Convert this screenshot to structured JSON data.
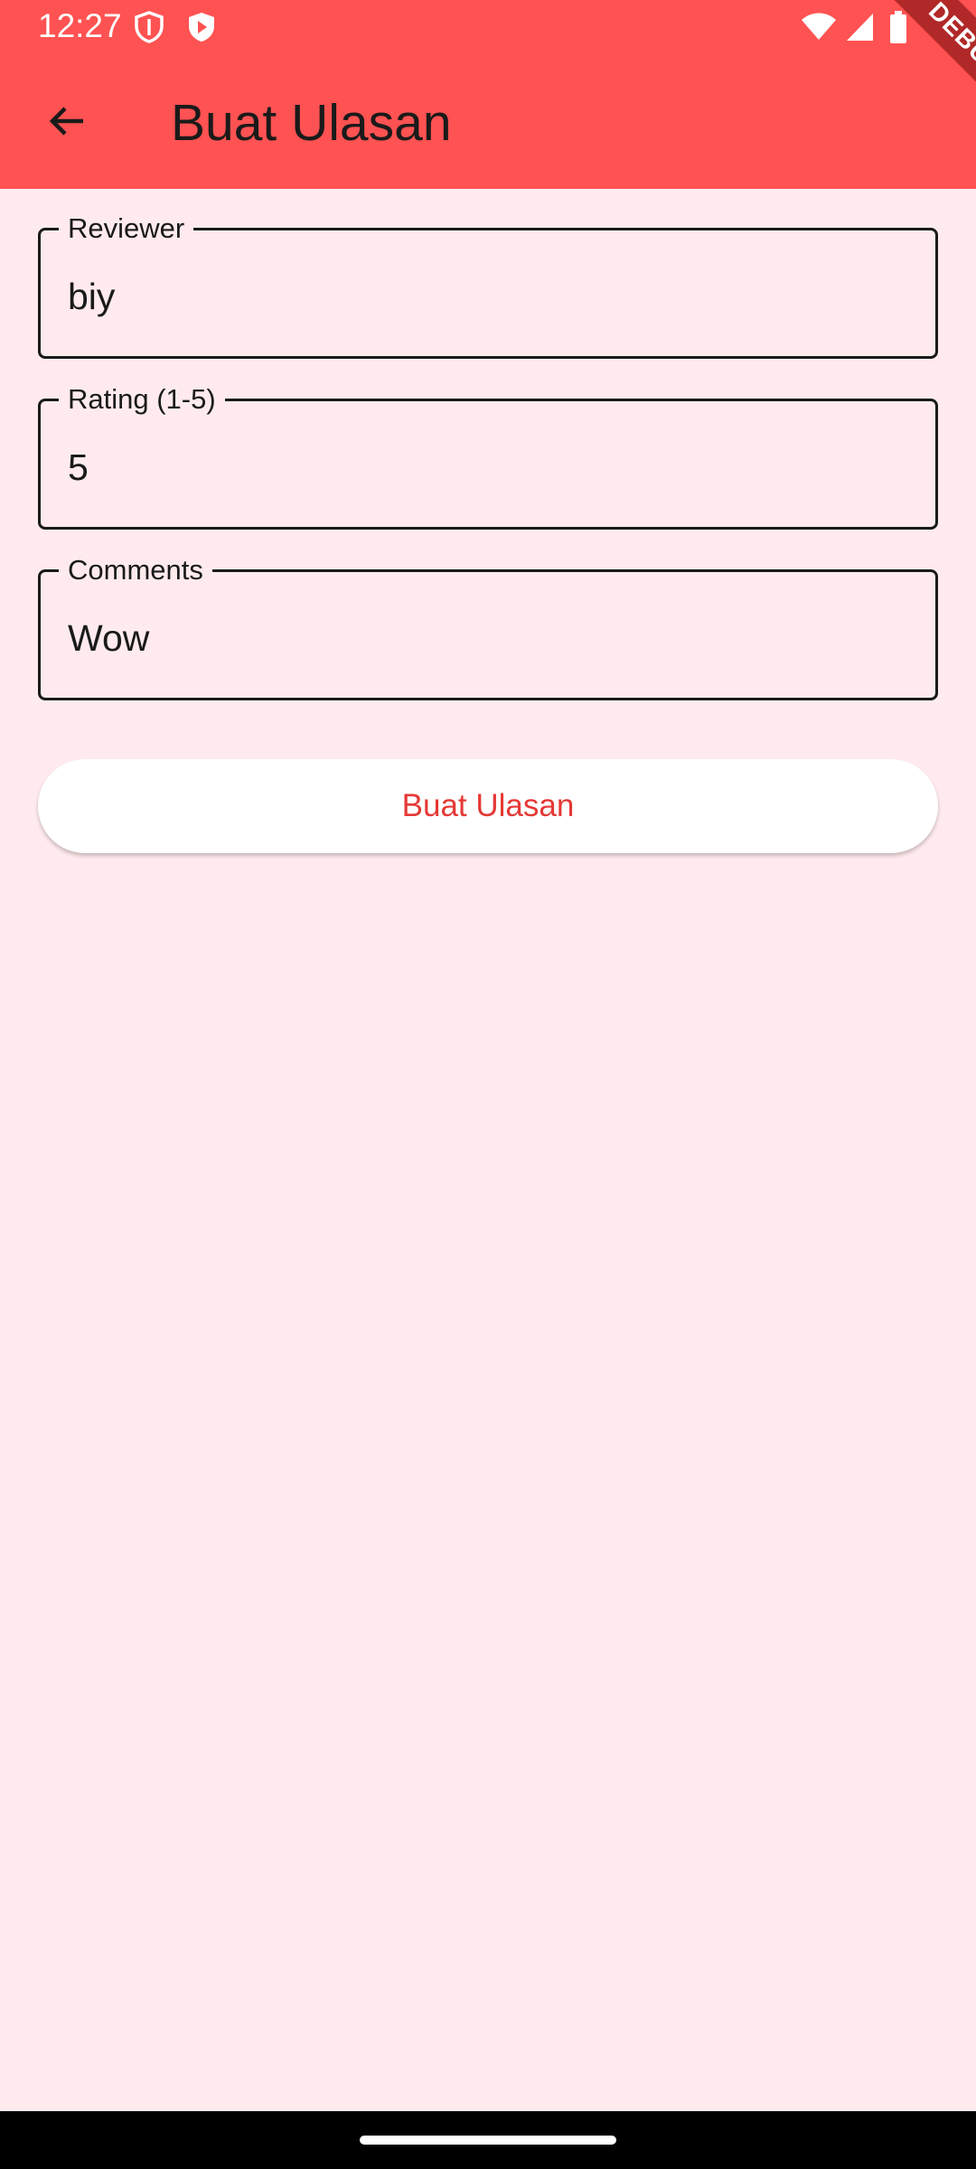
{
  "status_bar": {
    "time": "12:27",
    "icons": [
      "vpn-shield-icon",
      "play-shield-icon",
      "wifi-icon",
      "signal-icon",
      "battery-icon"
    ]
  },
  "app_bar": {
    "title": "Buat Ulasan",
    "back_icon": "arrow-back-icon",
    "debug_banner": "DEBUG",
    "background_color": "#ff5252"
  },
  "form": {
    "fields": [
      {
        "label": "Reviewer",
        "value": "biy"
      },
      {
        "label": "Rating (1-5)",
        "value": "5"
      },
      {
        "label": "Comments",
        "value": "Wow"
      }
    ],
    "submit_label": "Buat Ulasan",
    "accent_color": "#e53935",
    "page_background": "#ffebee"
  }
}
